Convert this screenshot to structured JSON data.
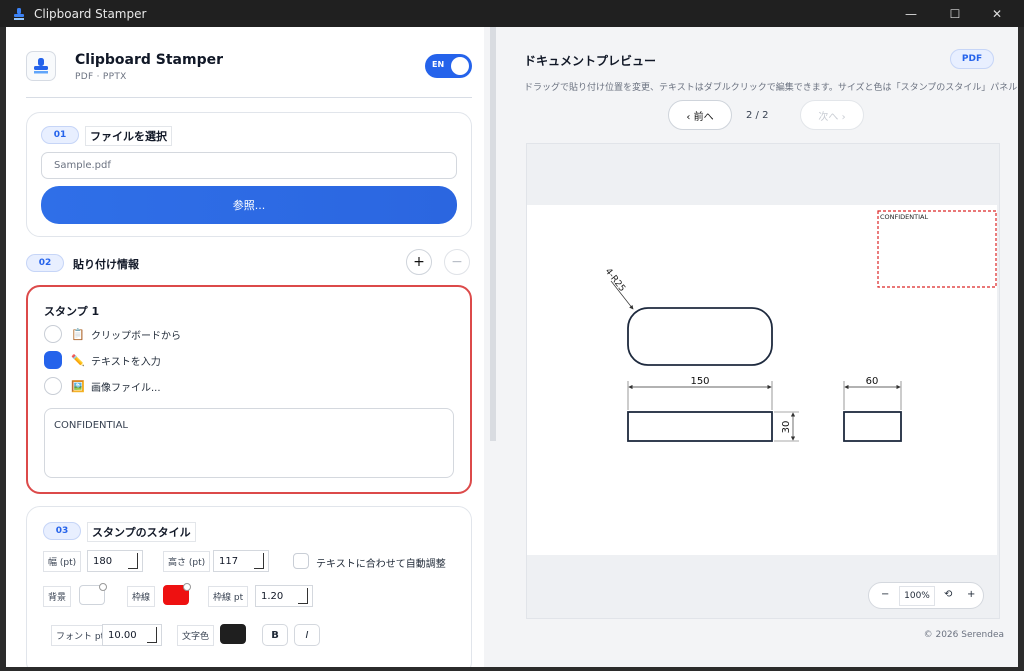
{
  "window": {
    "title": "Clipboard Stamper"
  },
  "brand": {
    "name": "Clipboard Stamper",
    "subtitle": "PDF · PPTX",
    "lang": "EN"
  },
  "step1": {
    "num": "01",
    "title": "ファイルを選択",
    "file": "Sample.pdf",
    "browse": "参照..."
  },
  "step2": {
    "num": "02",
    "title": "貼り付け情報",
    "add": "+",
    "remove": "−",
    "stamp": {
      "title": "スタンプ 1",
      "options": [
        {
          "icon": "clipboard-icon",
          "glyph": "📋",
          "label": "クリップボードから",
          "checked": false
        },
        {
          "icon": "pencil-icon",
          "glyph": "✏️",
          "label": "テキストを入力",
          "checked": true
        },
        {
          "icon": "image-icon",
          "glyph": "🖼️",
          "label": "画像ファイル...",
          "checked": false
        }
      ],
      "text": "CONFIDENTIAL"
    }
  },
  "step3": {
    "num": "03",
    "title": "スタンプのスタイル",
    "width_label": "幅 (pt)",
    "width": "180",
    "height_label": "高さ (pt)",
    "height": "117",
    "autofit_label": "テキストに合わせて自動調整",
    "bg_label": "背景",
    "border_label": "枠線",
    "border_pt_label": "枠線 pt",
    "border_pt": "1.20",
    "font_pt_label": "フォント pt",
    "font_pt": "10.00",
    "text_color_label": "文字色",
    "bold": "B",
    "italic": "I",
    "colors": {
      "background": "#ffffff",
      "border": "#ee1111",
      "text": "#1f1f1f"
    }
  },
  "preview": {
    "title": "ドキュメントプレビュー",
    "badge": "PDF",
    "hint": "ドラッグで貼り付け位置を変更、テキストはダブルクリックで編集できます。サイズと色は「スタンプのスタイル」パネルで設定します。",
    "prev": "‹ 前へ",
    "next": "次へ ›",
    "page": "2 / 2",
    "stamp_text": "CONFIDENTIAL",
    "drawing": {
      "radius_label": "4-R25",
      "dim1": "150",
      "dim2": "30",
      "dim3": "60"
    },
    "zoom": {
      "minus": "−",
      "value": "100%",
      "reset": "⟲",
      "plus": "+"
    }
  },
  "footer": {
    "copyright": "© 2026 Serendea"
  }
}
